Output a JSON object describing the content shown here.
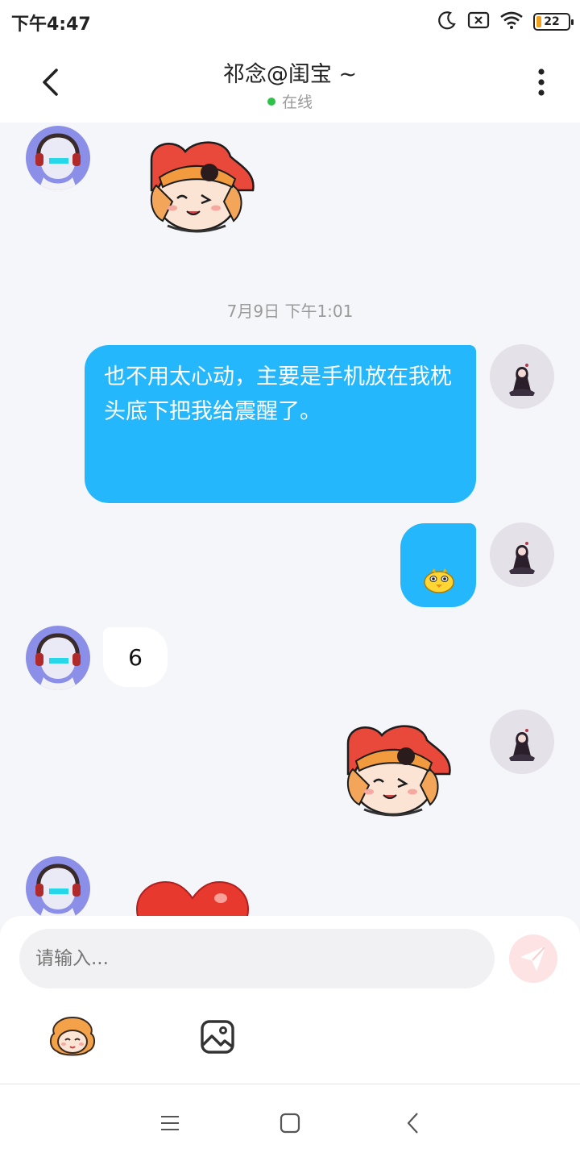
{
  "status_bar": {
    "time": "下午4:47",
    "battery": "22",
    "icons": [
      "moon-icon",
      "no-sim-icon",
      "wifi-icon",
      "battery-icon"
    ]
  },
  "header": {
    "title": "祁念@闺宝 ~",
    "status": "在线",
    "icons": [
      "back-arrow-icon",
      "more-vertical-icon"
    ],
    "status_color": "#2fc24a"
  },
  "chat": {
    "timestamp": "7月9日 下午1:01",
    "messages": [
      {
        "from": "other",
        "type": "sticker",
        "sticker": "red-heart-character-sticker"
      },
      {
        "from": "me",
        "type": "text",
        "text": "也不用太心动，主要是手机放在我枕头底下把我给震醒了。"
      },
      {
        "from": "me",
        "type": "emoji",
        "sticker": "yellow-chick-emoji"
      },
      {
        "from": "other",
        "type": "text",
        "text": "6"
      },
      {
        "from": "me",
        "type": "sticker",
        "sticker": "red-heart-character-sticker"
      },
      {
        "from": "other",
        "type": "sticker",
        "sticker": "red-heart-sticker"
      }
    ],
    "bubble_color": "#25b7fb"
  },
  "input": {
    "placeholder": "请输入..."
  },
  "toolbar": {
    "icons": [
      "sticker-panel-icon",
      "image-icon",
      "send-icon"
    ]
  },
  "nav_bar": {
    "icons": [
      "menu-icon",
      "home-icon",
      "back-icon"
    ]
  }
}
